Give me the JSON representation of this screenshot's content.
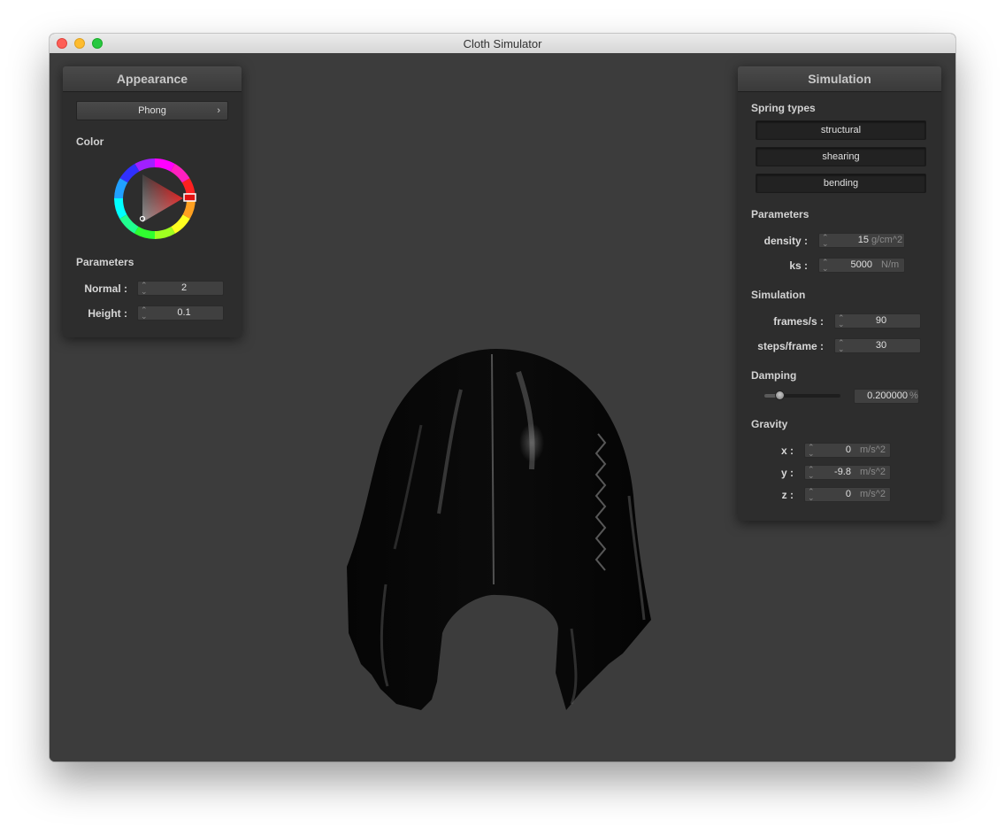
{
  "window": {
    "title": "Cloth Simulator"
  },
  "appearance": {
    "title": "Appearance",
    "shader": "Phong",
    "color_label": "Color",
    "color_selected": "#e01010",
    "parameters_label": "Parameters",
    "normal": {
      "label": "Normal :",
      "value": "2"
    },
    "height": {
      "label": "Height :",
      "value": "0.1"
    }
  },
  "simulation_panel": {
    "title": "Simulation",
    "spring_types_label": "Spring types",
    "spring_types": [
      "structural",
      "shearing",
      "bending"
    ],
    "parameters_label": "Parameters",
    "density": {
      "label": "density :",
      "value": "15",
      "unit": "g/cm^2"
    },
    "ks": {
      "label": "ks :",
      "value": "5000",
      "unit": "N/m"
    },
    "simulation_label": "Simulation",
    "frames": {
      "label": "frames/s :",
      "value": "90"
    },
    "steps": {
      "label": "steps/frame :",
      "value": "30"
    },
    "damping_label": "Damping",
    "damping": {
      "value": "0.200000",
      "unit": "%",
      "fraction": 0.2
    },
    "gravity_label": "Gravity",
    "gravity": {
      "x": {
        "label": "x :",
        "value": "0",
        "unit": "m/s^2"
      },
      "y": {
        "label": "y :",
        "value": "-9.8",
        "unit": "m/s^2"
      },
      "z": {
        "label": "z :",
        "value": "0",
        "unit": "m/s^2"
      }
    }
  }
}
